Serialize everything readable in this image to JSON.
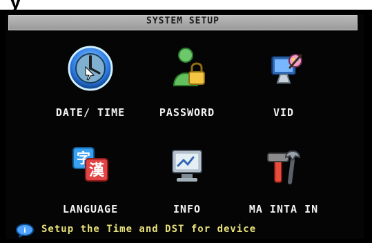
{
  "header": {
    "fragment": "y"
  },
  "window": {
    "title": "SYSTEM SETUP"
  },
  "menu": {
    "items": [
      {
        "label": "DATE/ TIME",
        "icon": "clock-icon"
      },
      {
        "label": "PASSWORD",
        "icon": "user-lock-icon"
      },
      {
        "label": "VID",
        "icon": "display-palette-icon"
      },
      {
        "label": "LANGUAGE",
        "icon": "language-icon"
      },
      {
        "label": "INFO",
        "icon": "info-monitor-icon"
      },
      {
        "label": "MA INTA IN",
        "icon": "tools-icon"
      }
    ]
  },
  "status": {
    "text": "Setup the Time and DST for device",
    "icon": "speech-bubble-icon"
  },
  "colors": {
    "status_text": "#e7e17a",
    "panel_bg": "#050505",
    "titlebar": "#aaaaaa"
  }
}
